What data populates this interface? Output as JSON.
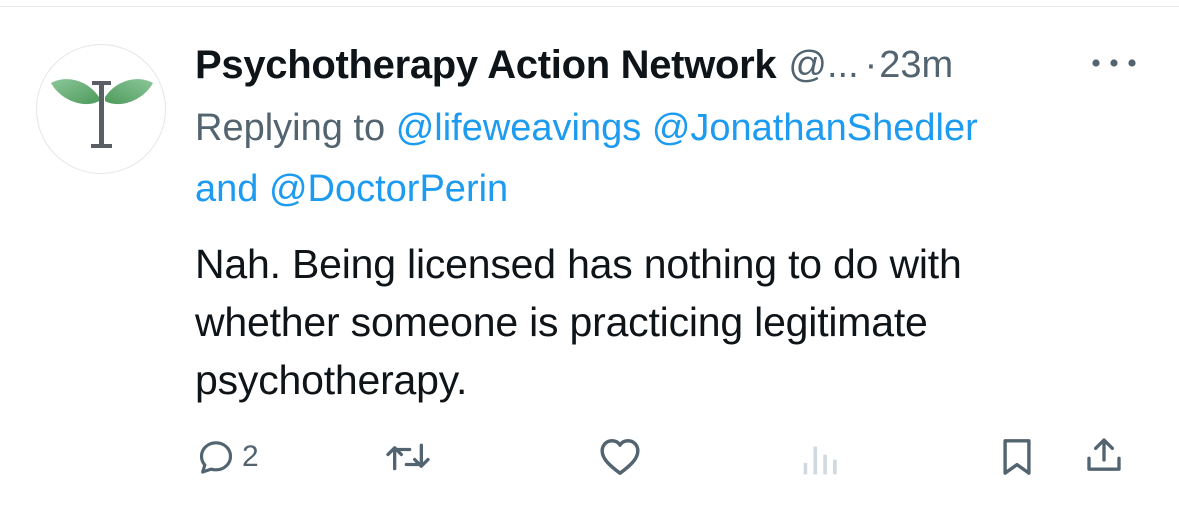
{
  "tweet": {
    "author": {
      "display_name": "Psychotherapy Action Network",
      "handle": "@...",
      "avatar_icon": "sprout-caduceus-logo"
    },
    "separator": "·",
    "timestamp": "23m",
    "replying": {
      "prefix": "Replying to",
      "mentions": [
        "@lifeweavings",
        "@JonathanShedler",
        "@DoctorPerin"
      ],
      "conjunction": "and"
    },
    "text_lines": [
      "Nah. Being licensed has nothing to do with",
      "whether someone is practicing legitimate",
      "psychotherapy."
    ],
    "actions": {
      "reply": {
        "icon": "reply-icon",
        "count": "2"
      },
      "retweet": {
        "icon": "retweet-icon"
      },
      "like": {
        "icon": "heart-icon"
      },
      "views": {
        "icon": "analytics-icon"
      },
      "bookmark": {
        "icon": "bookmark-icon"
      },
      "share": {
        "icon": "share-icon"
      }
    },
    "more_icon": "more-horizontal-icon"
  },
  "colors": {
    "text_primary": "#0f1419",
    "text_secondary": "#536471",
    "link": "#1d9bf0",
    "logo_green": "#5fa86a",
    "views_icon_disabled": "#cfd9de"
  }
}
